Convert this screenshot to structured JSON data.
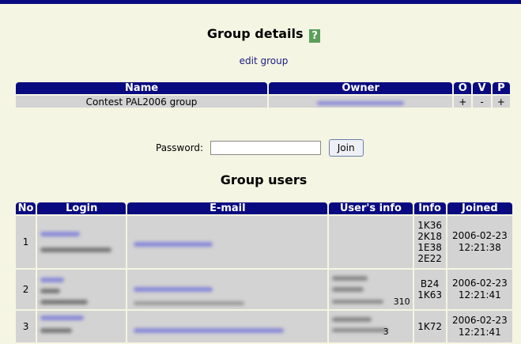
{
  "header": {
    "title": "Group details",
    "help_label": "?",
    "edit_link": "edit group"
  },
  "group_table": {
    "columns": [
      "Name",
      "Owner",
      "O",
      "V",
      "P"
    ],
    "row": {
      "name": "Contest PAL2006 group",
      "o": "+",
      "v": "-",
      "p": "+"
    }
  },
  "password": {
    "label": "Password:",
    "value": "",
    "button": "Join"
  },
  "users": {
    "title": "Group users",
    "columns": [
      "No",
      "Login",
      "E-mail",
      "User's info",
      "Info",
      "Joined"
    ],
    "rows": [
      {
        "no": "1",
        "info": [
          "1K36",
          "2K18",
          "1E38",
          "2E22"
        ],
        "joined_date": "2006-02-23",
        "joined_time": "12:21:38",
        "user_info_suffix": ""
      },
      {
        "no": "2",
        "info": [
          "B24",
          "1K63"
        ],
        "joined_date": "2006-02-23",
        "joined_time": "12:21:41",
        "user_info_suffix": "310"
      },
      {
        "no": "3",
        "info": [
          "1K72"
        ],
        "joined_date": "2006-02-23",
        "joined_time": "12:21:41",
        "user_info_suffix": "3"
      }
    ]
  },
  "colors": {
    "header_bg": "#0a0a80",
    "page_bg": "#f5f5e3",
    "cell_bg": "#d3d3d3",
    "help_bg": "#5aa05a"
  }
}
